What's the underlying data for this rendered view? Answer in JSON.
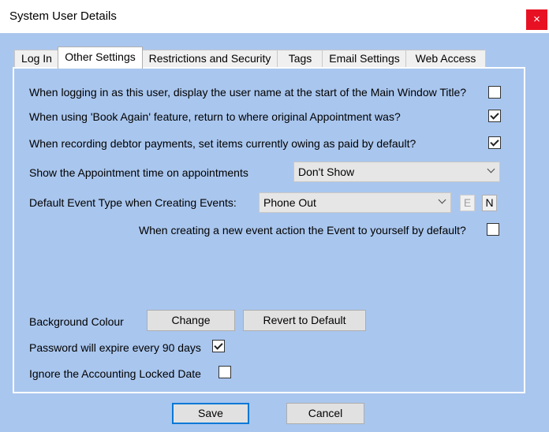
{
  "window": {
    "title": "System User Details",
    "close_glyph": "×"
  },
  "tabs": [
    {
      "label": "Log In"
    },
    {
      "label": "Other Settings"
    },
    {
      "label": "Restrictions and Security"
    },
    {
      "label": "Tags"
    },
    {
      "label": "Email Settings"
    },
    {
      "label": "Web Access"
    }
  ],
  "active_tab": "Other Settings",
  "settings": {
    "display_username_title": {
      "label": "When logging in as this user, display the user name at the start of the Main Window Title?",
      "checked": false
    },
    "book_again_return": {
      "label": "When using 'Book Again' feature, return to where original Appointment was?",
      "checked": true
    },
    "debtor_payments_paid": {
      "label": "When recording debtor payments, set items currently owing as paid by default?",
      "checked": true
    },
    "appointment_time": {
      "label": "Show the Appointment time on appointments",
      "value": "Don't Show"
    },
    "default_event_type": {
      "label": "Default Event Type when Creating Events:",
      "value": "Phone Out",
      "edit_label": "E",
      "new_label": "N"
    },
    "event_action_self": {
      "label": "When creating a new event action the Event to yourself by default?",
      "checked": false
    },
    "background_colour": {
      "label": "Background Colour",
      "change_label": "Change",
      "revert_label": "Revert to Default"
    },
    "password_expire": {
      "label": "Password will expire every 90 days",
      "checked": true
    },
    "ignore_accounting_locked": {
      "label": "Ignore the Accounting Locked Date",
      "checked": false
    }
  },
  "footer": {
    "save_label": "Save",
    "cancel_label": "Cancel"
  },
  "colors": {
    "client_bg": "#a9c6ee",
    "close_bg": "#e81123",
    "default_button_border": "#0078d7"
  }
}
